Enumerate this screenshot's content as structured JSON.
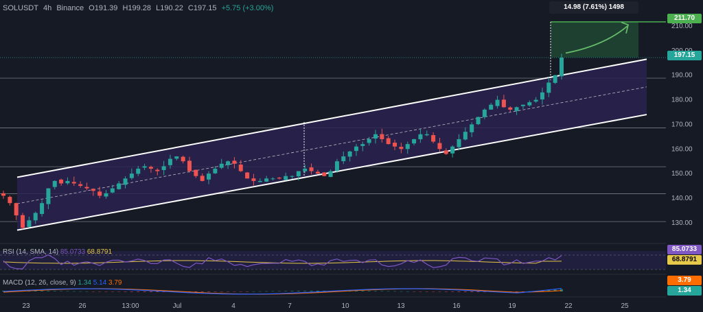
{
  "header": {
    "symbol": "SOLUSDT",
    "interval": "4h",
    "exchange": "Binance",
    "open": "O191.39",
    "high": "H199.28",
    "low": "L190.22",
    "close": "C197.15",
    "change": "+5.75 (+3.00%)"
  },
  "measure_label": "14.98 (7.61%) 1498",
  "target_price": "211.70",
  "current_price": "197.15",
  "rsi": {
    "label": "RSI (14, SMA, 14)",
    "value": "85.0733",
    "sma": "68.8791"
  },
  "macd": {
    "label": "MACD (12, 26, close, 9)",
    "macd": "1.34",
    "signal": "5.14",
    "hist": "3.79"
  },
  "colors": {
    "up": "#26a69a",
    "down": "#ef5350",
    "channel": "#ffffff",
    "channel_fill": "#2a2350",
    "rsi": "#7e57c2",
    "rsi_sma": "#e6c84a",
    "macd": "#2962ff",
    "signal": "#ff6d00",
    "target_box": "#1f4a33",
    "arrow": "#66bb6a"
  },
  "chart_data": {
    "type": "candlestick",
    "ylim": [
      123,
      215
    ],
    "y_ticks": [
      "130.00",
      "140.00",
      "150.00",
      "160.00",
      "170.00",
      "180.00",
      "190.00",
      "200.00",
      "210.00"
    ],
    "x_ticks": [
      "23",
      "26",
      "13:00",
      "Jul",
      "4",
      "7",
      "10",
      "13",
      "16",
      "19",
      "22",
      "25"
    ],
    "horizontal_levels": [
      130.5,
      141.8,
      152.8,
      168.6,
      188.8
    ],
    "channel": {
      "upper_start": 148.5,
      "upper_end": 196.5,
      "lower_start": 127.0,
      "lower_end": 174.0
    },
    "close_path": [
      141,
      138,
      133,
      128,
      131,
      134,
      138,
      144,
      147,
      146,
      147,
      146,
      145,
      144,
      143,
      141,
      142,
      144,
      146,
      148,
      150,
      152,
      153,
      152,
      151,
      153,
      156,
      157,
      155,
      151,
      149,
      147,
      150,
      152,
      154,
      155,
      154,
      151,
      148,
      147,
      147,
      148,
      148,
      148,
      149,
      149,
      151,
      152,
      151,
      150,
      149,
      151,
      155,
      157,
      159,
      161,
      162,
      164,
      166,
      164,
      162,
      161,
      160,
      162,
      164,
      166,
      166,
      163,
      160,
      158,
      161,
      164,
      167,
      170,
      173,
      176,
      178,
      180,
      177,
      176,
      177,
      178,
      179,
      180,
      183,
      187,
      190,
      197.15
    ]
  }
}
